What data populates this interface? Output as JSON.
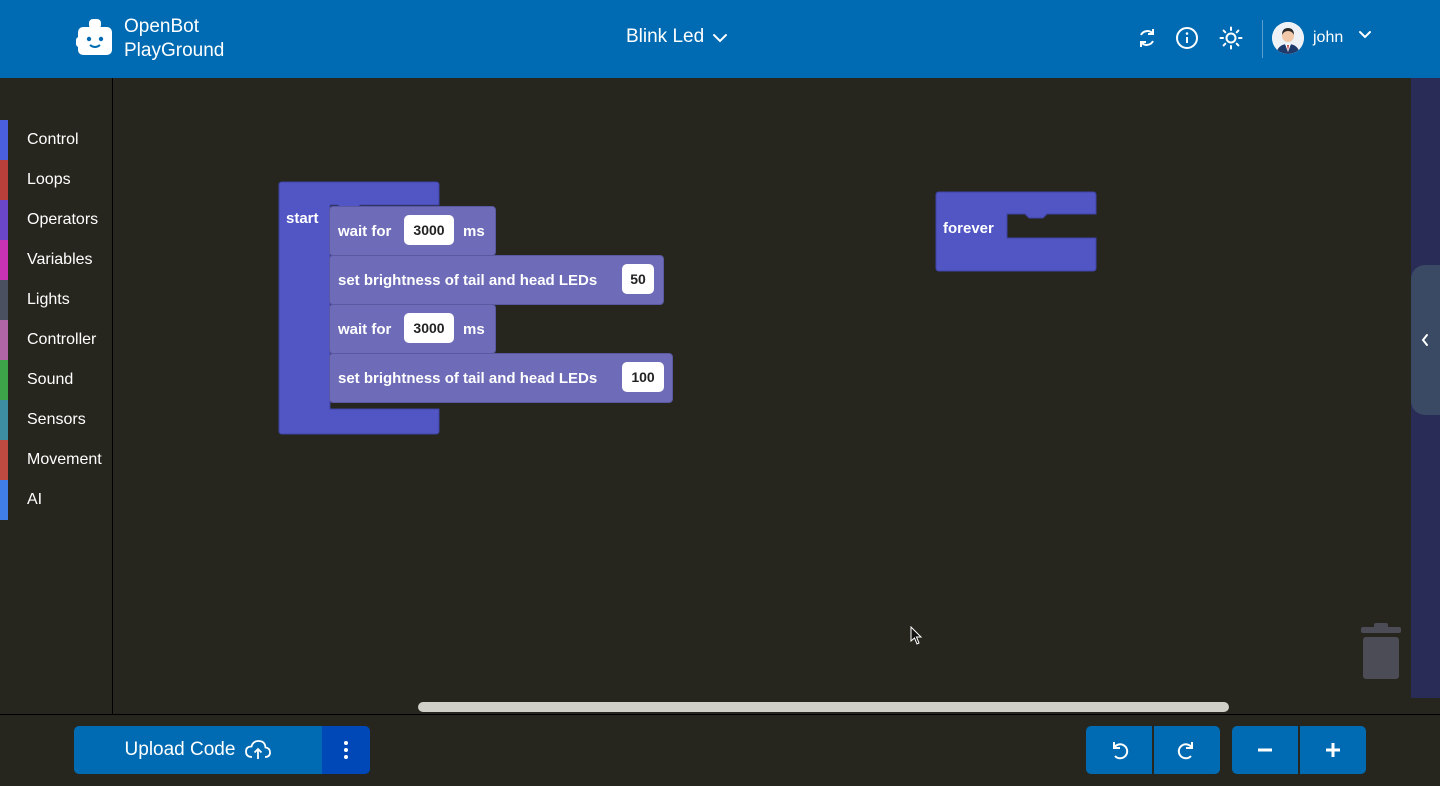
{
  "header": {
    "brand_line1": "OpenBot",
    "brand_line2": "PlayGround",
    "project_name": "Blink Led",
    "username": "john",
    "icons": [
      "refresh-icon",
      "info-icon",
      "theme-sun-icon",
      "chevron-down-icon"
    ]
  },
  "sidebar": {
    "categories": [
      {
        "label": "Control",
        "color": "#4a5fe0"
      },
      {
        "label": "Loops",
        "color": "#b9403a"
      },
      {
        "label": "Operators",
        "color": "#6b46c8"
      },
      {
        "label": "Variables",
        "color": "#c732b5"
      },
      {
        "label": "Lights",
        "color": "#4a5060"
      },
      {
        "label": "Controller",
        "color": "#b066a6"
      },
      {
        "label": "Sound",
        "color": "#3ea44a"
      },
      {
        "label": "Sensors",
        "color": "#3c8ea0"
      },
      {
        "label": "Movement",
        "color": "#c04a40"
      },
      {
        "label": "AI",
        "color": "#3f7fe6"
      }
    ]
  },
  "blocks": {
    "start": {
      "label": "start",
      "statements": [
        {
          "text": "wait for",
          "value": "3000",
          "suffix": "ms"
        },
        {
          "text": "set brightness of tail and head LEDs",
          "value": "50"
        },
        {
          "text": "wait for",
          "value": "3000",
          "suffix": "ms"
        },
        {
          "text": "set brightness of tail and head LEDs",
          "value": "100"
        }
      ]
    },
    "forever": {
      "label": "forever"
    }
  },
  "footer": {
    "upload_label": "Upload Code",
    "controls": [
      "undo-icon",
      "redo-icon",
      "zoom-out-icon",
      "zoom-in-icon"
    ]
  },
  "colors": {
    "header": "#006bb2",
    "workspace": "#26261e",
    "start_block": "#5156c4",
    "statement_block": "#6e6cb8",
    "forever_block": "#5156c4"
  }
}
